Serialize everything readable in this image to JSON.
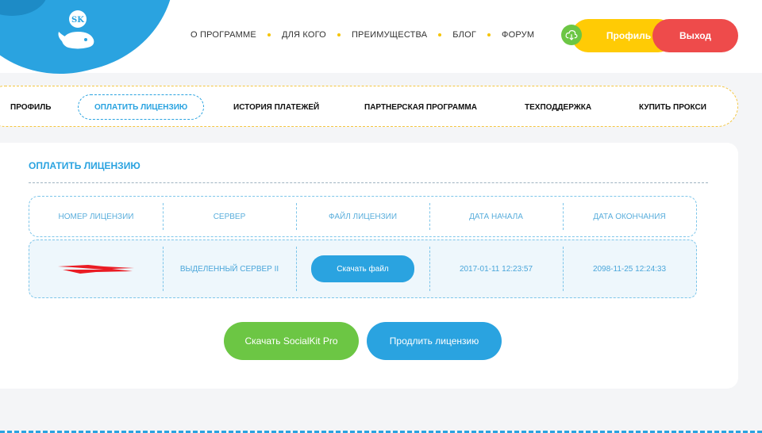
{
  "logo": {
    "text": "SK",
    "icon": "whale-icon"
  },
  "nav": {
    "items": [
      "О ПРОГРАММЕ",
      "ДЛЯ КОГО",
      "ПРЕИМУЩЕСТВА",
      "БЛОГ",
      "ФОРУМ"
    ]
  },
  "header": {
    "profile_label": "Профиль",
    "logout_label": "Выход",
    "cloud_icon": "cloud-download-icon"
  },
  "tabs": [
    {
      "label": "ПРОФИЛЬ"
    },
    {
      "label": "ОПЛАТИТЬ ЛИЦЕНЗИЮ",
      "active": true
    },
    {
      "label": "ИСТОРИЯ ПЛАТЕЖЕЙ"
    },
    {
      "label": "ПАРТНЕРСКАЯ ПРОГРАММА"
    },
    {
      "label": "ТЕХПОДДЕРЖКА"
    },
    {
      "label": "КУПИТЬ ПРОКСИ"
    }
  ],
  "section": {
    "title": "ОПЛАТИТЬ ЛИЦЕНЗИЮ",
    "columns": [
      "НОМЕР ЛИЦЕНЗИИ",
      "СЕРВЕР",
      "ФАЙЛ ЛИЦЕНЗИИ",
      "ДАТА НАЧАЛА",
      "ДАТА ОКОНЧАНИЯ"
    ],
    "row": {
      "server": "ВЫДЕЛЕННЫЙ СЕРВЕР II",
      "file_button": "Скачать файл",
      "start_date": "2017-01-11 12:23:57",
      "end_date": "2098-11-25 12:24:33"
    },
    "download_button": "Скачать SocialKit Pro",
    "extend_button": "Продлить лицензию"
  },
  "colors": {
    "accent_blue": "#2aa3e0",
    "green": "#6cc644",
    "yellow": "#ffcb05",
    "red": "#ee4b4b"
  }
}
